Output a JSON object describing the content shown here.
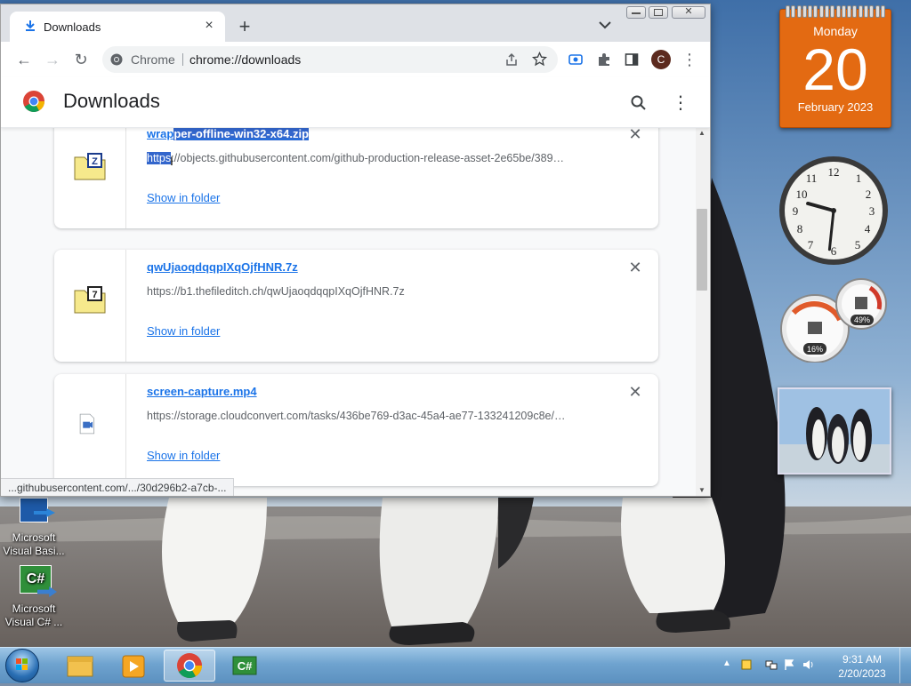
{
  "browser": {
    "tab_title": "Downloads",
    "new_tab": "+",
    "close_tab": "×",
    "omnibox_site": "Chrome",
    "omnibox_url": "chrome://downloads",
    "profile_initial": "C"
  },
  "page": {
    "title": "Downloads"
  },
  "downloads": [
    {
      "name_selected_prefix": "wrap",
      "name_selected": "per-offline-win32-x64.zip",
      "url_selected": "https",
      "url_rest": "://objects.githubusercontent.com/github-production-release-asset-2e65be/389…",
      "action": "Show in folder",
      "icon": "zip-archive-icon",
      "badge": "Z"
    },
    {
      "name": "qwUjaoqdqqpIXqOjfHNR.7z",
      "url": "https://b1.thefileditch.ch/qwUjaoqdqqpIXqOjfHNR.7z",
      "action": "Show in folder",
      "icon": "7z-archive-icon",
      "badge": "7"
    },
    {
      "name": "screen-capture.mp4",
      "url": "https://storage.cloudconvert.com/tasks/436be769-d3ac-45a4-ae77-133241209c8e/…",
      "action": "Show in folder",
      "icon": "video-file-icon"
    }
  ],
  "status_bar": "...githubusercontent.com/.../30d296b2-a7cb-...",
  "desktop_icons": [
    {
      "label_line1": "Microsoft",
      "label_line2": "Visual Basi..."
    },
    {
      "label_line1": "Microsoft",
      "label_line2": "Visual C# ..."
    }
  ],
  "calendar": {
    "weekday": "Monday",
    "day": "20",
    "month_year": "February 2023"
  },
  "clock": {
    "hour": 9,
    "minute": 31
  },
  "meters": {
    "cpu": "16%",
    "memory": "49%"
  },
  "taskbar": {
    "time": "9:31 AM",
    "date": "2/20/2023"
  },
  "colors": {
    "link": "#1a73e8",
    "calendar": "#e36a12",
    "selection": "#3366cc"
  }
}
